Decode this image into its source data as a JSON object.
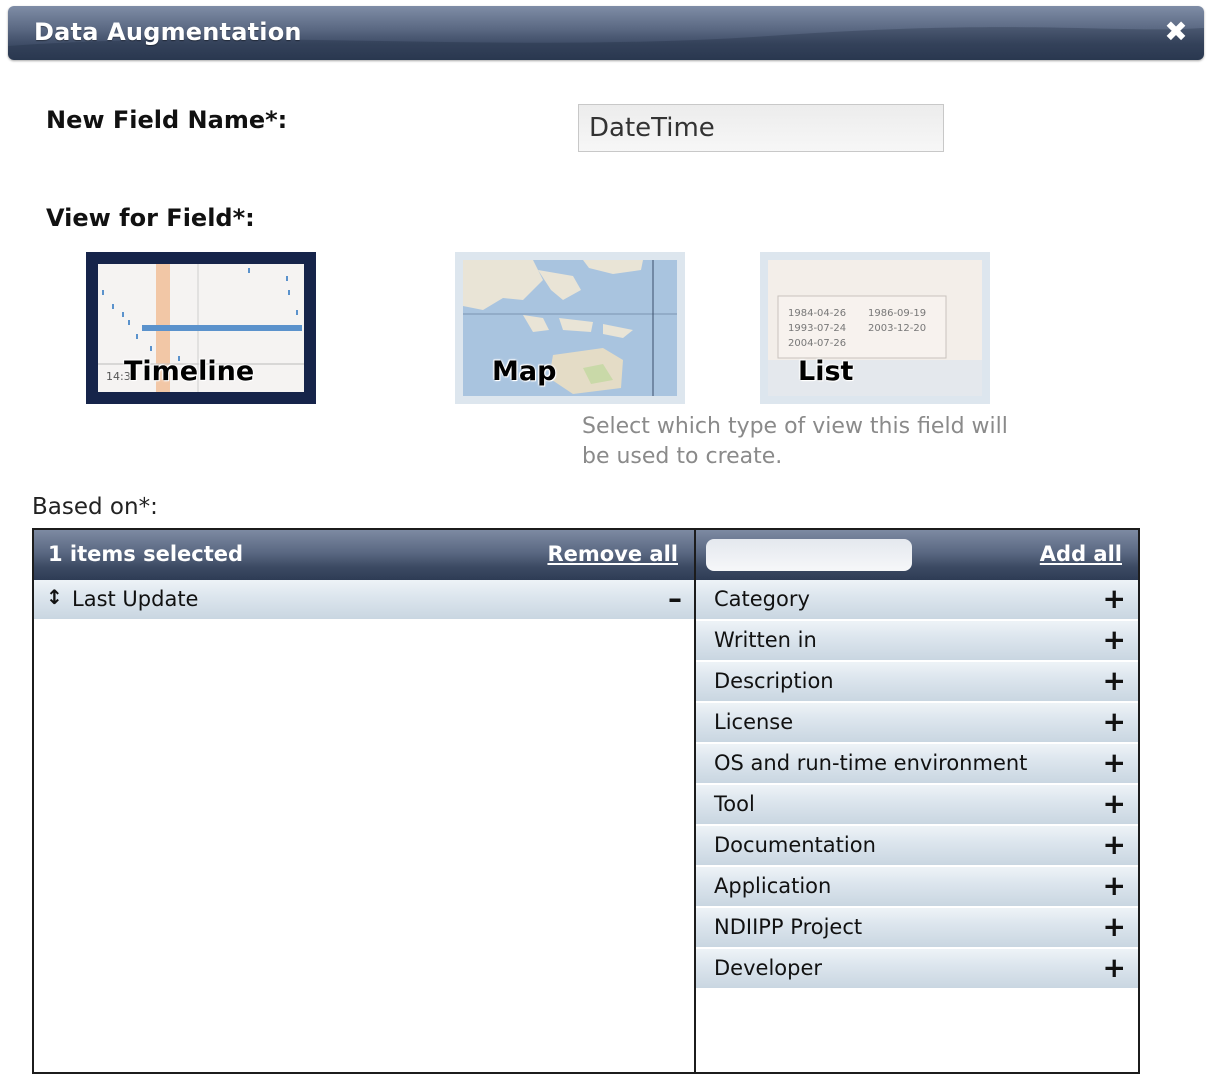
{
  "dialog": {
    "title": "Data Augmentation",
    "close_icon": "close-icon"
  },
  "new_field": {
    "label": "New Field Name*:",
    "value": "DateTime"
  },
  "view_for_field": {
    "label": "View for Field*:",
    "options": [
      {
        "label": "Timeline",
        "selected": true
      },
      {
        "label": "Map",
        "selected": false
      },
      {
        "label": "List",
        "selected": false
      }
    ],
    "help": "Select which type of view this field will be used to create.",
    "timeline_thumb_text": "14:3",
    "list_thumb_dates": [
      "1984-04-26",
      "1986-09-19",
      "1993-07-24",
      "2003-12-20",
      "2004-07-26"
    ]
  },
  "based_on": {
    "label": "Based on*:",
    "selected_header": "1 items selected",
    "remove_all": "Remove all",
    "add_all": "Add all",
    "search_placeholder": "",
    "selected_items": [
      "Last Update"
    ],
    "available_items": [
      "Category",
      "Written in",
      "Description",
      "License",
      "OS and run-time environment",
      "Tool",
      "Documentation",
      "Application",
      "NDIIPP Project",
      "Developer"
    ],
    "add_symbol": "+",
    "remove_symbol": "–",
    "drag_symbol": "↕"
  },
  "colors": {
    "title_bar": "#3f4d67",
    "selected_border": "#16244a",
    "row_gradient": "#dde6ee"
  }
}
